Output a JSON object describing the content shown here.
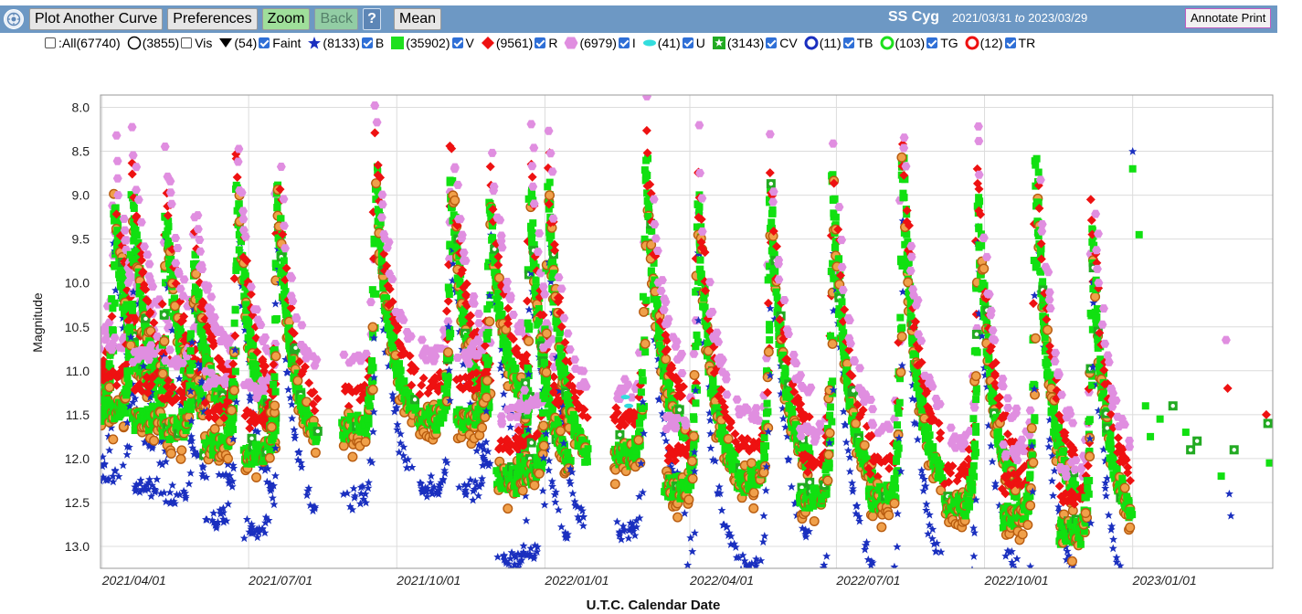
{
  "toolbar": {
    "plot_another_curve": "Plot Another Curve",
    "preferences": "Preferences",
    "zoom": "Zoom",
    "back": "Back",
    "help": "?",
    "mean": "Mean",
    "star_name": "SS Cyg",
    "date_from": "2021/03/31",
    "date_to_word": "to",
    "date_to": "2023/03/29",
    "annotate_print": "Annotate Print",
    "logo_icon": "aavso-logo-icon"
  },
  "legend": [
    {
      "key": "all",
      "symbol": "none",
      "checkbox": false,
      "count": "(67740)",
      "label": ":All",
      "color": "#000000"
    },
    {
      "key": "vis",
      "symbol": "open-circle",
      "checkbox": false,
      "count": "(3855)",
      "label": "Vis",
      "color": "#000000"
    },
    {
      "key": "faint",
      "symbol": "down-triangle",
      "checkbox": true,
      "count": "(54)",
      "label": "Faint",
      "color": "#000000"
    },
    {
      "key": "B",
      "symbol": "star",
      "checkbox": true,
      "count": "(8133)",
      "label": "B",
      "color": "#1a2fbf"
    },
    {
      "key": "V",
      "symbol": "square",
      "checkbox": true,
      "count": "(35902)",
      "label": "V",
      "color": "#1ee01e"
    },
    {
      "key": "R",
      "symbol": "diamond",
      "checkbox": true,
      "count": "(9561)",
      "label": "R",
      "color": "#ee1111"
    },
    {
      "key": "I",
      "symbol": "hexagon",
      "checkbox": true,
      "count": "(6979)",
      "label": "I",
      "color": "#e08ee0"
    },
    {
      "key": "U",
      "symbol": "ellipse",
      "checkbox": true,
      "count": "(41)",
      "label": "U",
      "color": "#33dddd"
    },
    {
      "key": "CV",
      "symbol": "square-star",
      "checkbox": true,
      "count": "(3143)",
      "label": "CV",
      "color": "#22aa22"
    },
    {
      "key": "TB",
      "symbol": "ring",
      "checkbox": true,
      "count": "(11)",
      "label": "TB",
      "color": "#1a2fbf"
    },
    {
      "key": "TG",
      "symbol": "ring",
      "checkbox": true,
      "count": "(103)",
      "label": "TG",
      "color": "#1ee01e"
    },
    {
      "key": "TR",
      "symbol": "ring",
      "checkbox": true,
      "count": "(12)",
      "label": "TR",
      "color": "#ee1111"
    }
  ],
  "chart_data": {
    "type": "scatter",
    "title": "",
    "xlabel": "U.T.C. Calendar Date",
    "ylabel": "Magnitude",
    "x_range": [
      "2021-03-31",
      "2023-03-29"
    ],
    "ylim": [
      8.0,
      13.2
    ],
    "y_inverted": true,
    "grid": true,
    "x_ticks": [
      "2021/04/01",
      "2021/07/01",
      "2021/10/01",
      "2022/01/01",
      "2022/04/01",
      "2022/07/01",
      "2022/10/01",
      "2023/01/01"
    ],
    "y_ticks": [
      "8.0",
      "8.5",
      "9.0",
      "9.5",
      "10.0",
      "10.5",
      "11.0",
      "11.5",
      "12.0",
      "12.5",
      "13.0"
    ],
    "outbursts": [
      {
        "date": "2021-04-11",
        "peak": 9.1,
        "quiescent": 11.3
      },
      {
        "date": "2021-04-22",
        "peak": 9.0,
        "quiescent": 11.4
      },
      {
        "date": "2021-05-13",
        "peak": 9.2,
        "quiescent": 11.5
      },
      {
        "date": "2021-05-30",
        "peak": 9.7,
        "quiescent": 11.6
      },
      {
        "date": "2021-06-26",
        "peak": 8.9,
        "quiescent": 11.8
      },
      {
        "date": "2021-07-21",
        "peak": 8.9,
        "quiescent": 11.9
      },
      {
        "date": "2021-09-20",
        "peak": 8.7,
        "quiescent": 11.6
      },
      {
        "date": "2021-11-06",
        "peak": 8.8,
        "quiescent": 11.5
      },
      {
        "date": "2021-11-30",
        "peak": 9.0,
        "quiescent": 11.5
      },
      {
        "date": "2021-12-25",
        "peak": 8.9,
        "quiescent": 12.2
      },
      {
        "date": "2022-01-05",
        "peak": 8.9,
        "quiescent": 12.1
      },
      {
        "date": "2022-03-07",
        "peak": 8.6,
        "quiescent": 11.9
      },
      {
        "date": "2022-04-08",
        "peak": 9.0,
        "quiescent": 12.3
      },
      {
        "date": "2022-05-23",
        "peak": 9.0,
        "quiescent": 12.2
      },
      {
        "date": "2022-07-01",
        "peak": 8.8,
        "quiescent": 12.4
      },
      {
        "date": "2022-08-13",
        "peak": 8.6,
        "quiescent": 12.4
      },
      {
        "date": "2022-09-29",
        "peak": 9.0,
        "quiescent": 12.5
      },
      {
        "date": "2022-11-04",
        "peak": 8.6,
        "quiescent": 12.6
      },
      {
        "date": "2022-12-09",
        "peak": 9.4,
        "quiescent": 12.8
      }
    ],
    "sparse_points": [
      {
        "date": "2023-01-01",
        "mag": 8.7,
        "band": "V"
      },
      {
        "date": "2023-01-01",
        "mag": 8.5,
        "band": "B"
      },
      {
        "date": "2023-01-05",
        "mag": 9.45,
        "band": "V"
      },
      {
        "date": "2023-01-09",
        "mag": 11.4,
        "band": "V"
      },
      {
        "date": "2023-01-12",
        "mag": 11.75,
        "band": "V"
      },
      {
        "date": "2023-01-18",
        "mag": 11.55,
        "band": "V"
      },
      {
        "date": "2023-01-26",
        "mag": 11.4,
        "band": "CV"
      },
      {
        "date": "2023-02-03",
        "mag": 11.7,
        "band": "V"
      },
      {
        "date": "2023-02-06",
        "mag": 11.9,
        "band": "CV"
      },
      {
        "date": "2023-02-10",
        "mag": 11.8,
        "band": "CV"
      },
      {
        "date": "2023-02-25",
        "mag": 12.2,
        "band": "V"
      },
      {
        "date": "2023-02-28",
        "mag": 10.65,
        "band": "I"
      },
      {
        "date": "2023-03-01",
        "mag": 11.2,
        "band": "R"
      },
      {
        "date": "2023-03-02",
        "mag": 12.4,
        "band": "B"
      },
      {
        "date": "2023-03-03",
        "mag": 12.65,
        "band": "B"
      },
      {
        "date": "2023-03-05",
        "mag": 11.9,
        "band": "CV"
      },
      {
        "date": "2023-03-25",
        "mag": 11.5,
        "band": "R"
      },
      {
        "date": "2023-03-26",
        "mag": 11.6,
        "band": "CV"
      },
      {
        "date": "2023-03-27",
        "mag": 12.05,
        "band": "V"
      }
    ],
    "band_colors": {
      "V": "#11e011",
      "B": "#1a2fbf",
      "R": "#ee1111",
      "I": "#e08ee0",
      "Vis": "#e8891c",
      "CV": "#22aa22",
      "U": "#33dddd"
    }
  }
}
